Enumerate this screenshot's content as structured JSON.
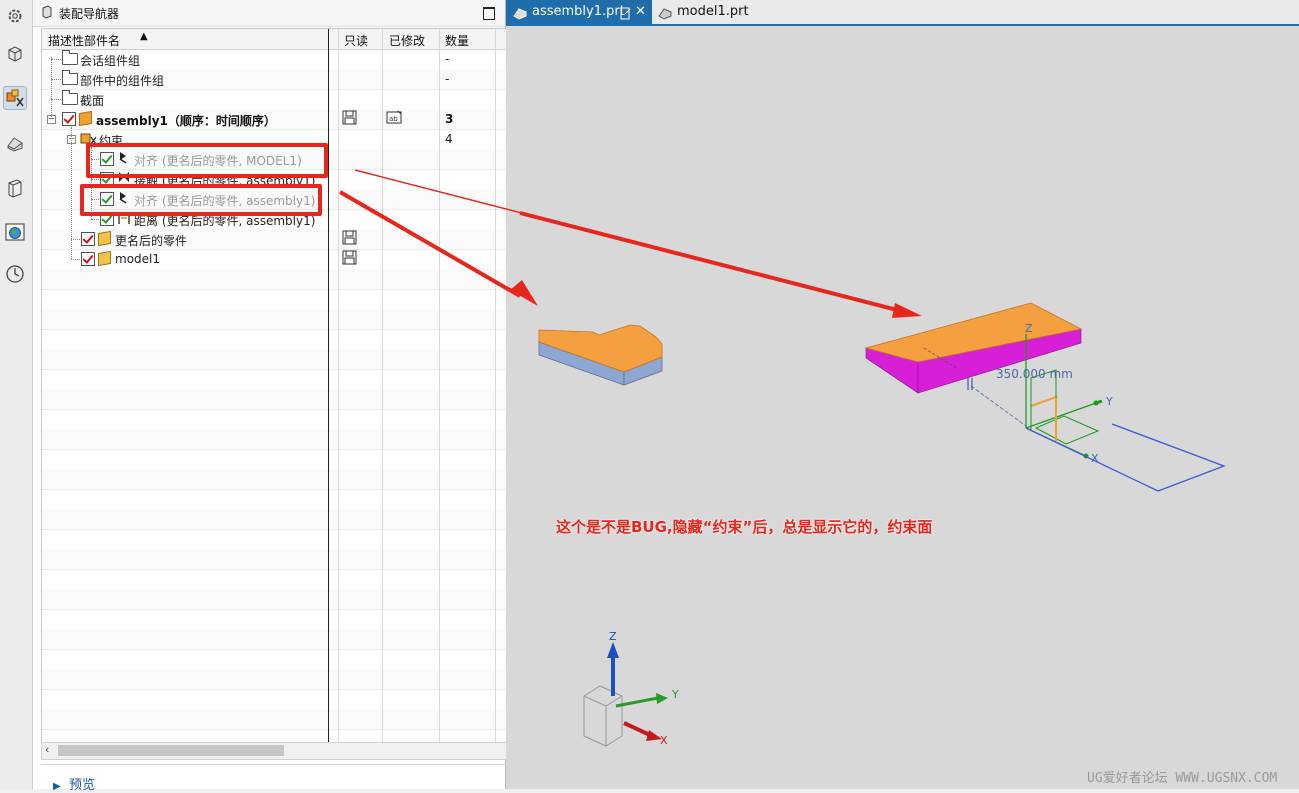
{
  "navigator": {
    "title": "装配导航器",
    "columns": [
      "描述性部件名",
      "只读",
      "已修改",
      "数量"
    ]
  },
  "tree": [
    {
      "label": "会话组件组",
      "qty": "-"
    },
    {
      "label": "部件中的组件组",
      "qty": "-"
    },
    {
      "label": "截面",
      "qty": ""
    },
    {
      "label": "assembly1（顺序：时间顺序）",
      "qty": "3"
    },
    {
      "label": "约束",
      "qty": "4"
    },
    {
      "label": "对齐 (更名后的零件, MODEL1)",
      "qty": ""
    },
    {
      "label": "接触 (更名后的零件, assembly1)",
      "qty": ""
    },
    {
      "label": "对齐 (更名后的零件, assembly1)",
      "qty": ""
    },
    {
      "label": "距离 (更名后的零件, assembly1)",
      "qty": ""
    },
    {
      "label": "更名后的零件",
      "qty": ""
    },
    {
      "label": "model1",
      "qty": ""
    }
  ],
  "preview_label": "预览",
  "tabs": [
    {
      "label": "assembly1.prt"
    },
    {
      "label": "model1.prt"
    }
  ],
  "viewport": {
    "dimension_label": "350.000 mm",
    "axis_x": "X",
    "axis_y": "Y",
    "axis_z": "Z"
  },
  "annotation": "这个是不是BUG,隐藏“约束”后，总是显示它的，约束面",
  "watermark": "UG爱好者论坛 WWW.UGSNX.COM",
  "colors": {
    "highlight_red": "#e8261d",
    "part_orange": "#f5a040",
    "part_magenta": "#d81fd8",
    "part_blue_side": "#8ea6d2",
    "tab_active": "#1f6eab"
  }
}
